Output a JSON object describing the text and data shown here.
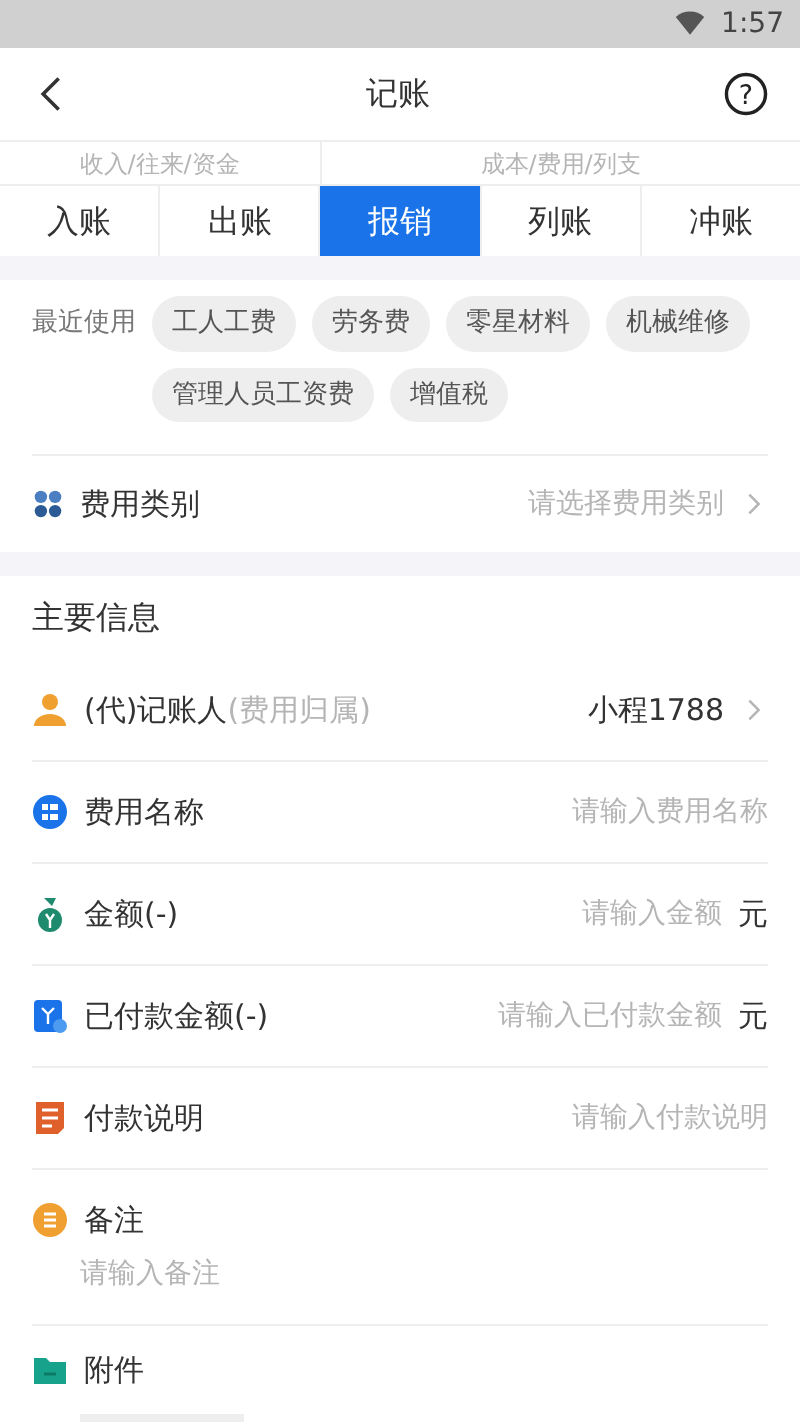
{
  "status_bar": {
    "time": "1:57"
  },
  "header": {
    "title": "记账",
    "help": "?"
  },
  "tab_groups": [
    {
      "label": "收入/往来/资金",
      "tabs": [
        {
          "label": "入账",
          "selected": false
        },
        {
          "label": "出账",
          "selected": false
        }
      ]
    },
    {
      "label": "成本/费用/列支",
      "tabs": [
        {
          "label": "报销",
          "selected": true
        },
        {
          "label": "列账",
          "selected": false
        },
        {
          "label": "冲账",
          "selected": false
        }
      ]
    }
  ],
  "recent": {
    "label": "最近使用",
    "chips": [
      "工人工费",
      "劳务费",
      "零星材料",
      "机械维修",
      "管理人员工资费",
      "增值税"
    ]
  },
  "category": {
    "label": "费用类别",
    "placeholder": "请选择费用类别"
  },
  "section_title": "主要信息",
  "fields": [
    {
      "kind": "select",
      "label": "(代)记账人",
      "note": "(费用归属)",
      "value": "小程1788"
    },
    {
      "kind": "input",
      "label": "费用名称",
      "placeholder": "请输入费用名称"
    },
    {
      "kind": "input",
      "label": "金额(-)",
      "placeholder": "请输入金额",
      "unit": "元"
    },
    {
      "kind": "input",
      "label": "已付款金额(-)",
      "placeholder": "请输入已付款金额",
      "unit": "元"
    },
    {
      "kind": "input",
      "label": "付款说明",
      "placeholder": "请输入付款说明"
    },
    {
      "kind": "textarea",
      "label": "备注",
      "placeholder": "请输入备注"
    },
    {
      "kind": "attachment",
      "label": "附件"
    }
  ]
}
